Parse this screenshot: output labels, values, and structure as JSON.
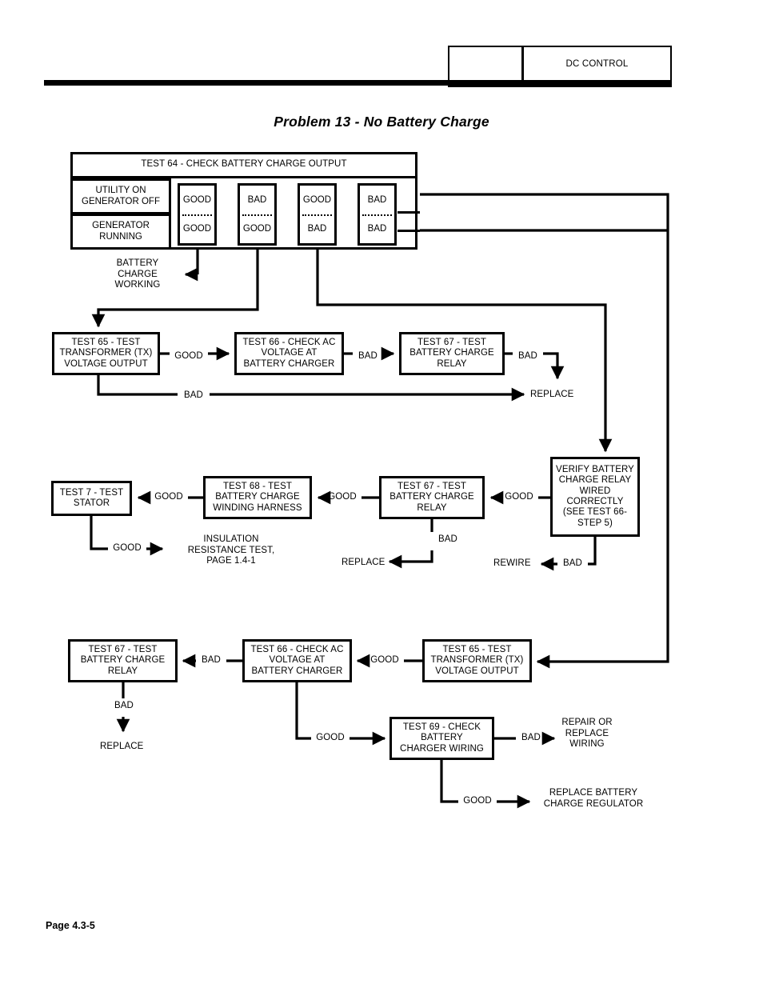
{
  "header": {
    "left_cell": "",
    "section_label": "DC CONTROL"
  },
  "title": "Problem 13 - No Battery Charge",
  "footer": "Page 4.3-5",
  "test64": {
    "title": "TEST 64 - CHECK BATTERY CHARGE OUTPUT",
    "row_labels": [
      "UTILITY ON\nGENERATOR OFF",
      "GENERATOR\nRUNNING"
    ],
    "row1_label_line1": "UTILITY ON",
    "row1_label_line2": "GENERATOR OFF",
    "row2_label_line1": "GENERATOR",
    "row2_label_line2": "RUNNING",
    "columns": [
      {
        "utility_on": "GOOD",
        "generator_running": "GOOD"
      },
      {
        "utility_on": "BAD",
        "generator_running": "GOOD"
      },
      {
        "utility_on": "GOOD",
        "generator_running": "BAD"
      },
      {
        "utility_on": "BAD",
        "generator_running": "BAD"
      }
    ]
  },
  "boxes": {
    "battery_charge_working": "BATTERY\nCHARGE\nWORKING",
    "bcw_l1": "BATTERY",
    "bcw_l2": "CHARGE",
    "bcw_l3": "WORKING",
    "test65_a_l1": "TEST 65 - TEST",
    "test65_a_l2": "TRANSFORMER (TX)",
    "test65_a_l3": "VOLTAGE OUTPUT",
    "test66_a_l1": "TEST 66 - CHECK AC",
    "test66_a_l2": "VOLTAGE AT",
    "test66_a_l3": "BATTERY CHARGER",
    "test67_a_l1": "TEST 67 - TEST",
    "test67_a_l2": "BATTERY CHARGE",
    "test67_a_l3": "RELAY",
    "verify_l1": "VERIFY BATTERY",
    "verify_l2": "CHARGE RELAY",
    "verify_l3": "WIRED",
    "verify_l4": "CORRECTLY",
    "verify_l5": "(SEE TEST 66-",
    "verify_l6": "STEP 5)",
    "test67_b_l1": "TEST 67 - TEST",
    "test67_b_l2": "BATTERY CHARGE",
    "test67_b_l3": "RELAY",
    "test68_l1": "TEST 68 - TEST",
    "test68_l2": "BATTERY CHARGE",
    "test68_l3": "WINDING HARNESS",
    "test7_l1": "TEST 7 - TEST",
    "test7_l2": "STATOR",
    "test67_c_l1": "TEST 67 - TEST",
    "test67_c_l2": "BATTERY CHARGE",
    "test67_c_l3": "RELAY",
    "test66_b_l1": "TEST 66 - CHECK AC",
    "test66_b_l2": "VOLTAGE AT",
    "test66_b_l3": "BATTERY CHARGER",
    "test65_b_l1": "TEST 65 - TEST",
    "test65_b_l2": "TRANSFORMER (TX)",
    "test65_b_l3": "VOLTAGE OUTPUT",
    "test69_l1": "TEST 69 - CHECK",
    "test69_l2": "BATTERY",
    "test69_l3": "CHARGER WIRING"
  },
  "terminals": {
    "replace_1": "REPLACE",
    "insulation_l1": "INSULATION",
    "insulation_l2": "RESISTANCE TEST,",
    "insulation_l3": "PAGE 1.4-1",
    "replace_2": "REPLACE",
    "rewire": "REWIRE",
    "replace_3": "REPLACE",
    "repair_l1": "REPAIR OR",
    "repair_l2": "REPLACE",
    "repair_l3": "WIRING",
    "replace_reg_l1": "REPLACE BATTERY",
    "replace_reg_l2": "CHARGE REGULATOR"
  },
  "edge_labels": {
    "good": "GOOD",
    "bad": "BAD",
    "e1_good": "GOOD",
    "e1_bad": "BAD",
    "e2_bad": "BAD",
    "e3_bad": "BAD",
    "e4_good": "GOOD",
    "e5_good": "GOOD",
    "e6_good": "GOOD",
    "e7_good": "GOOD",
    "e8_bad": "BAD",
    "e9_bad": "BAD",
    "e10_bad": "BAD",
    "e11_good": "GOOD",
    "e12_bad": "BAD",
    "e13_good": "GOOD",
    "e14_bad": "BAD",
    "e15_good": "GOOD"
  },
  "colors": {
    "ink": "#000000",
    "paper": "#ffffff"
  }
}
